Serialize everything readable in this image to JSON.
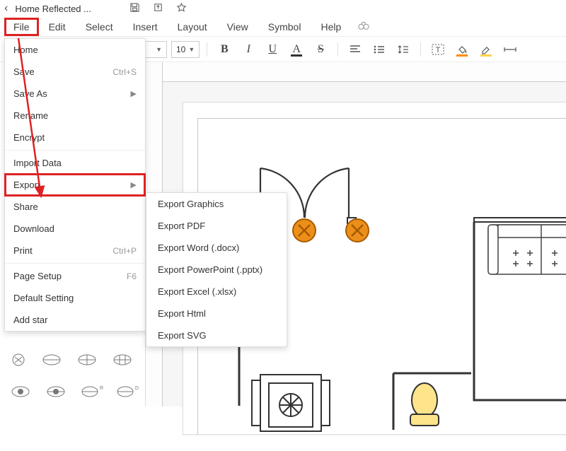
{
  "title": "Home Reflected ...",
  "menu": {
    "file": "File",
    "edit": "Edit",
    "select": "Select",
    "insert": "Insert",
    "layout": "Layout",
    "view": "View",
    "symbol": "Symbol",
    "help": "Help"
  },
  "toolbar": {
    "font_name": "",
    "font_size": "10",
    "bold": "B",
    "italic": "I",
    "underline": "U",
    "color_a": "A",
    "strike": "S",
    "textbox": "T"
  },
  "file_menu": {
    "home": "Home",
    "save": "Save",
    "save_hint": "Ctrl+S",
    "save_as": "Save As",
    "rename": "Rename",
    "encrypt": "Encrypt",
    "import": "Import Data",
    "export": "Export",
    "share": "Share",
    "download": "Download",
    "print": "Print",
    "print_hint": "Ctrl+P",
    "page_setup": "Page Setup",
    "page_setup_hint": "F6",
    "default_setting": "Default Setting",
    "add_star": "Add star"
  },
  "export_submenu": {
    "graphics": "Export Graphics",
    "pdf": "Export PDF",
    "word": "Export Word (.docx)",
    "ppt": "Export PowerPoint (.pptx)",
    "excel": "Export Excel (.xlsx)",
    "html": "Export Html",
    "svg": "Export SVG"
  }
}
